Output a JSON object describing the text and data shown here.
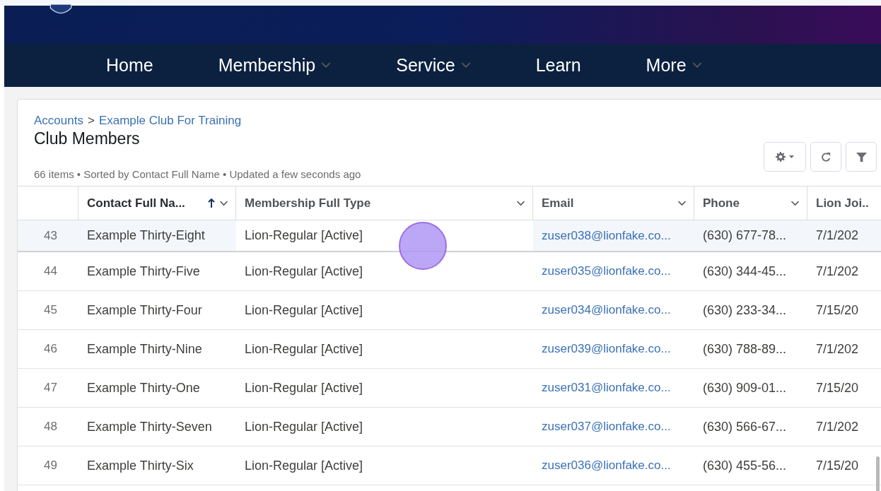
{
  "nav": [
    {
      "label": "Home",
      "dropdown": false
    },
    {
      "label": "Membership",
      "dropdown": true
    },
    {
      "label": "Service",
      "dropdown": true
    },
    {
      "label": "Learn",
      "dropdown": false
    },
    {
      "label": "More",
      "dropdown": true
    }
  ],
  "breadcrumb": [
    {
      "label": "Accounts"
    },
    {
      "label": "Example Club For Training"
    }
  ],
  "breadcrumb_separator": ">",
  "title": "Club Members",
  "info": "66 items • Sorted by Contact Full Name • Updated a few seconds ago",
  "table": {
    "columns": [
      {
        "label": "Contact Full Na...",
        "sorted": true
      },
      {
        "label": "Membership Full Type",
        "sorted": false
      },
      {
        "label": "Email",
        "sorted": false
      },
      {
        "label": "Phone",
        "sorted": false
      },
      {
        "label": "Lion Joi..",
        "sorted": false
      }
    ],
    "rows": [
      {
        "number": "43",
        "name": "Example Thirty-Eight",
        "type": "Lion-Regular [Active]",
        "email": "zuser038@lionfake.co...",
        "phone": "(630) 677-78...",
        "joined": "7/1/202",
        "selected": true
      },
      {
        "number": "44",
        "name": "Example Thirty-Five",
        "type": "Lion-Regular [Active]",
        "email": "zuser035@lionfake.co...",
        "phone": "(630) 344-45...",
        "joined": "7/1/202",
        "selected": false
      },
      {
        "number": "45",
        "name": "Example Thirty-Four",
        "type": "Lion-Regular [Active]",
        "email": "zuser034@lionfake.co...",
        "phone": "(630) 233-34...",
        "joined": "7/15/20",
        "selected": false
      },
      {
        "number": "46",
        "name": "Example Thirty-Nine",
        "type": "Lion-Regular [Active]",
        "email": "zuser039@lionfake.co...",
        "phone": "(630) 788-89...",
        "joined": "7/1/202",
        "selected": false
      },
      {
        "number": "47",
        "name": "Example Thirty-One",
        "type": "Lion-Regular [Active]",
        "email": "zuser031@lionfake.co...",
        "phone": "(630) 909-01...",
        "joined": "7/15/20",
        "selected": false
      },
      {
        "number": "48",
        "name": "Example Thirty-Seven",
        "type": "Lion-Regular [Active]",
        "email": "zuser037@lionfake.co...",
        "phone": "(630) 566-67...",
        "joined": "7/1/202",
        "selected": false
      },
      {
        "number": "49",
        "name": "Example Thirty-Six",
        "type": "Lion-Regular [Active]",
        "email": "zuser036@lionfake.co...",
        "phone": "(630) 455-56...",
        "joined": "7/15/20",
        "selected": false
      }
    ]
  }
}
